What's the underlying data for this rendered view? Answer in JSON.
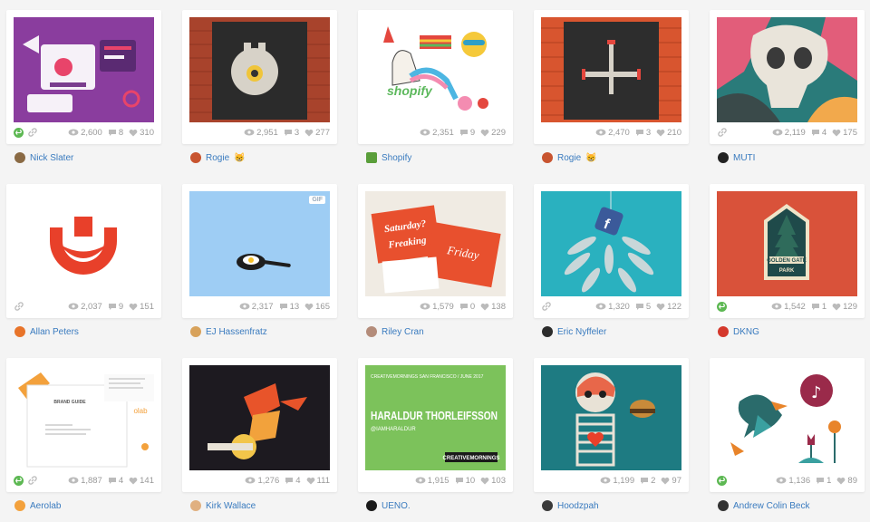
{
  "shots": [
    {
      "views": "2,600",
      "comments": "8",
      "likes": "310",
      "user": "Nick Slater",
      "badge": "",
      "rebound": true,
      "link": true,
      "avatar": "#8a6a44"
    },
    {
      "views": "2,951",
      "comments": "3",
      "likes": "277",
      "user": "Rogie",
      "badge": "😸",
      "rebound": false,
      "link": false,
      "avatar": "#c8542f"
    },
    {
      "views": "2,351",
      "comments": "9",
      "likes": "229",
      "user": "Shopify",
      "badge": "",
      "rebound": false,
      "link": false,
      "avatar": "#5a9e3a"
    },
    {
      "views": "2,470",
      "comments": "3",
      "likes": "210",
      "user": "Rogie",
      "badge": "😸",
      "rebound": false,
      "link": false,
      "avatar": "#c8542f"
    },
    {
      "views": "2,119",
      "comments": "4",
      "likes": "175",
      "user": "MUTI",
      "badge": "",
      "rebound": false,
      "link": true,
      "avatar": "#222222"
    },
    {
      "views": "2,037",
      "comments": "9",
      "likes": "151",
      "user": "Allan Peters",
      "badge": "",
      "rebound": false,
      "link": true,
      "avatar": "#e8742a"
    },
    {
      "views": "2,317",
      "comments": "13",
      "likes": "165",
      "user": "EJ Hassenfratz",
      "badge": "",
      "rebound": false,
      "link": false,
      "avatar": "#d8a25b",
      "gif": "GIF"
    },
    {
      "views": "1,579",
      "comments": "0",
      "likes": "138",
      "user": "Riley Cran",
      "badge": "",
      "rebound": false,
      "link": false,
      "avatar": "#b48c7a"
    },
    {
      "views": "1,320",
      "comments": "5",
      "likes": "122",
      "user": "Eric Nyffeler",
      "badge": "",
      "rebound": false,
      "link": true,
      "avatar": "#2c2c2c"
    },
    {
      "views": "1,542",
      "comments": "1",
      "likes": "129",
      "user": "DKNG",
      "badge": "",
      "rebound": true,
      "link": false,
      "avatar": "#d4382c"
    },
    {
      "views": "1,887",
      "comments": "4",
      "likes": "141",
      "user": "Aerolab",
      "badge": "",
      "rebound": true,
      "link": true,
      "avatar": "#f3a13c"
    },
    {
      "views": "1,276",
      "comments": "4",
      "likes": "111",
      "user": "Kirk Wallace",
      "badge": "",
      "rebound": false,
      "link": false,
      "avatar": "#e0b080"
    },
    {
      "views": "1,915",
      "comments": "10",
      "likes": "103",
      "user": "UENO.",
      "badge": "",
      "rebound": false,
      "link": false,
      "avatar": "#1a1a1a"
    },
    {
      "views": "1,199",
      "comments": "2",
      "likes": "97",
      "user": "Hoodzpah",
      "badge": "",
      "rebound": false,
      "link": false,
      "avatar": "#3a3a3a"
    },
    {
      "views": "1,136",
      "comments": "1",
      "likes": "89",
      "user": "Andrew Colin Beck",
      "badge": "",
      "rebound": true,
      "link": false,
      "avatar": "#333333"
    }
  ],
  "artwork": {
    "shopify_word": "shopify",
    "saturday_text": "Saturday?",
    "freaking_text": "Freaking",
    "friday_text": "Friday",
    "golden_gate_line1": "GOLDEN GATE",
    "golden_gate_line2": "PARK",
    "brand_guide_title": "BRAND GUIDE",
    "aerolab_word": "olab",
    "cm_header": "CREATIVEMORNINGS SAN FRANCISCO / JUNE 2017",
    "cm_name": "HARALDUR THORLEIFSSON",
    "cm_handle": "@IAMHARALDUR",
    "cm_logo": "CREATIVEMORNINGS"
  }
}
